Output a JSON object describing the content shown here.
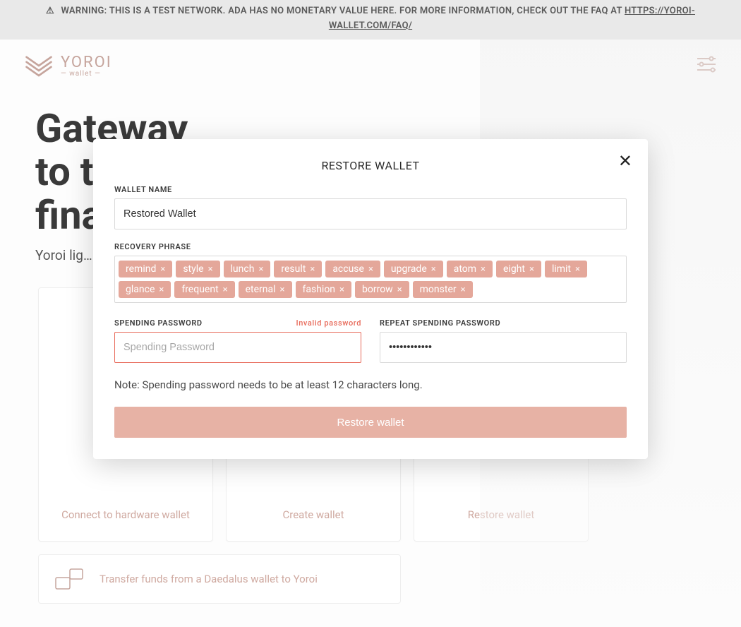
{
  "banner": {
    "warn_icon": "⚠",
    "text": "WARNING: THIS IS A TEST NETWORK. ADA HAS NO MONETARY VALUE HERE. FOR MORE INFORMATION, CHECK OUT THE FAQ AT ",
    "link_text": "HTTPS://YOROI-WALLET.COM/FAQ/"
  },
  "header": {
    "brand": "YOROI",
    "brand_sub": "— wallet —"
  },
  "hero": {
    "line1": "Gateway",
    "line2": "to the",
    "line3": "financial…",
    "tagline": "Yoroi lig…"
  },
  "cards": {
    "hardware": "Connect to hardware wallet",
    "create": "Create wallet",
    "restore": "Restore wallet",
    "transfer": "Transfer funds from a Daedalus wallet to Yoroi"
  },
  "modal": {
    "title": "RESTORE WALLET",
    "wallet_name_label": "WALLET NAME",
    "wallet_name_value": "Restored Wallet",
    "recovery_label": "RECOVERY PHRASE",
    "phrase": [
      "remind",
      "style",
      "lunch",
      "result",
      "accuse",
      "upgrade",
      "atom",
      "eight",
      "limit",
      "glance",
      "frequent",
      "eternal",
      "fashion",
      "borrow",
      "monster"
    ],
    "spending_label": "SPENDING PASSWORD",
    "spending_error": "Invalid password",
    "spending_placeholder": "Spending Password",
    "spending_value": "",
    "repeat_label": "REPEAT SPENDING PASSWORD",
    "repeat_value": "••••••••••••",
    "note": "Note: Spending password needs to be at least 12 characters long.",
    "submit": "Restore wallet"
  },
  "colors": {
    "accent": "#e4a79a",
    "error": "#e86a5a"
  }
}
